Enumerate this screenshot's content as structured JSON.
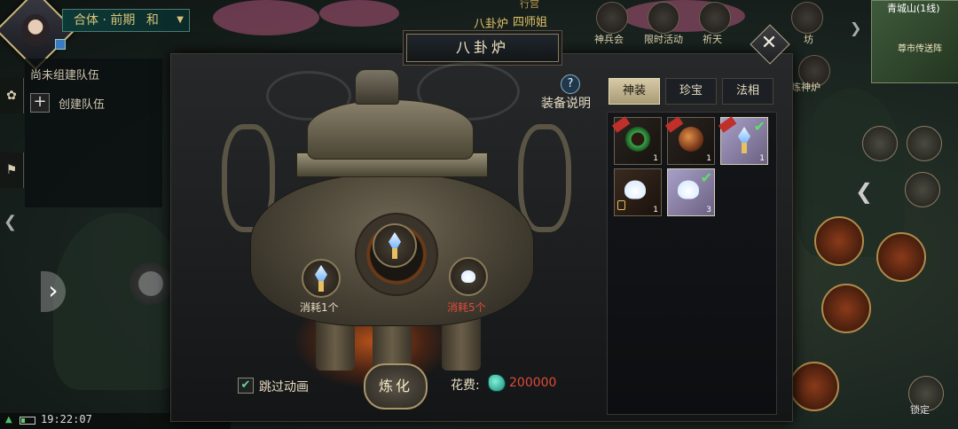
{
  "player": {
    "realm": "合体 · 前期",
    "realm_suffix": "和",
    "team_status": "尚未组建队伍",
    "team_create": "创建队伍"
  },
  "top_bar": {
    "label0": "行宫",
    "label1": "八卦炉",
    "label2": "四师姐",
    "icon_labels": [
      "神兵会",
      "限时活动",
      "祈天",
      "坊",
      "坊"
    ]
  },
  "minimap": {
    "title": "青城山(1线)",
    "note": "尊市传送阵",
    "right_label": "炼神炉"
  },
  "dialog": {
    "title": "八卦炉",
    "help_icon": "?",
    "help_label": "装备说明",
    "tabs": [
      {
        "label": "神装",
        "active": true
      },
      {
        "label": "珍宝",
        "active": false
      },
      {
        "label": "法相",
        "active": false
      }
    ],
    "cost_left": "消耗1个",
    "cost_right": "消耗5个",
    "skip_animation": "跳过动画",
    "refine_button": "炼化",
    "cost_label": "花费:",
    "cost_value": "200000"
  },
  "inventory": [
    {
      "icon": "jade-ring",
      "count": "1",
      "tag": true,
      "check": false,
      "lock": false
    },
    {
      "icon": "amber-orb",
      "count": "1",
      "tag": true,
      "check": false,
      "lock": false
    },
    {
      "icon": "crystal-lotus",
      "count": "1",
      "tag": true,
      "check": true,
      "lock": false
    },
    {
      "icon": "white-lotus",
      "count": "1",
      "tag": false,
      "check": false,
      "lock": true
    },
    {
      "icon": "white-lotus",
      "count": "3",
      "tag": false,
      "check": true,
      "lock": false
    }
  ],
  "status": {
    "time": "19:22:07",
    "lock_label": "锁定"
  },
  "colors": {
    "accent_gold": "#d9c27a",
    "cost_red": "#e24a3a",
    "check_green": "#5ee06a"
  }
}
